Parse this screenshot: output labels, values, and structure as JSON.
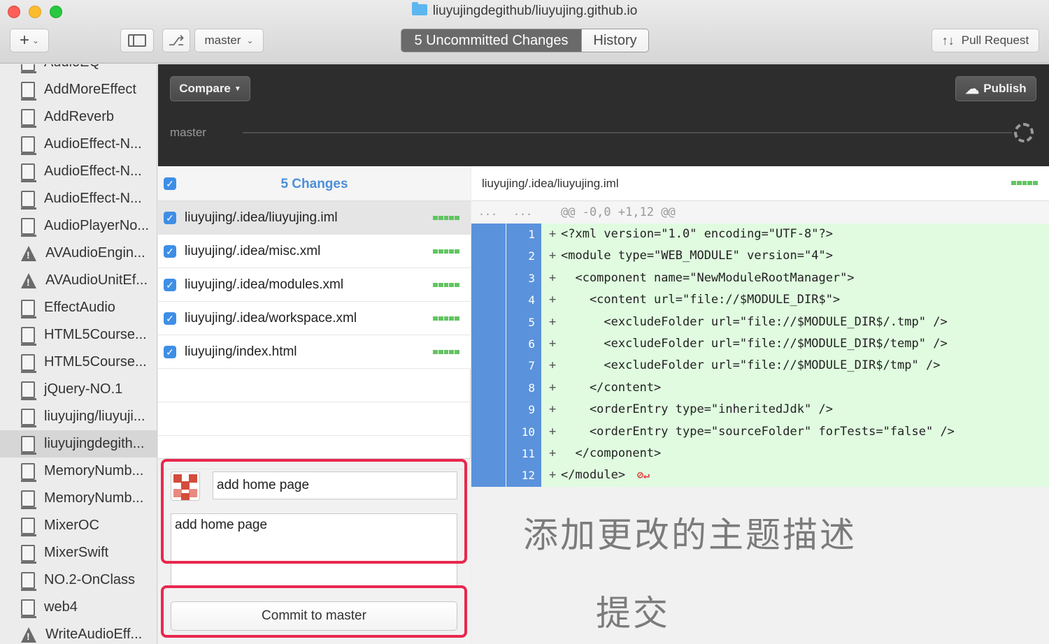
{
  "window": {
    "title": "liuyujingdegithub/liuyujing.github.io"
  },
  "toolbar": {
    "add_label": "+",
    "branch": "master",
    "tabs": [
      {
        "label": "5 Uncommitted Changes",
        "active": true
      },
      {
        "label": "History",
        "active": false
      }
    ],
    "pull_request_label": "Pull Request"
  },
  "sidebar": {
    "items": [
      {
        "label": "AudioEQ",
        "icon": "repo-icon"
      },
      {
        "label": "AddMoreEffect",
        "icon": "repo-icon"
      },
      {
        "label": "AddReverb",
        "icon": "repo-icon"
      },
      {
        "label": "AudioEffect-N...",
        "icon": "repo-icon"
      },
      {
        "label": "AudioEffect-N...",
        "icon": "repo-icon"
      },
      {
        "label": "AudioEffect-N...",
        "icon": "repo-icon"
      },
      {
        "label": "AudioPlayerNo...",
        "icon": "repo-icon"
      },
      {
        "label": "AVAudioEngin...",
        "icon": "warning-icon"
      },
      {
        "label": "AVAudioUnitEf...",
        "icon": "warning-icon"
      },
      {
        "label": "EffectAudio",
        "icon": "repo-icon"
      },
      {
        "label": "HTML5Course...",
        "icon": "repo-icon"
      },
      {
        "label": "HTML5Course...",
        "icon": "repo-icon"
      },
      {
        "label": "jQuery-NO.1",
        "icon": "repo-icon"
      },
      {
        "label": "liuyujing/liuyuji...",
        "icon": "repo-icon"
      },
      {
        "label": "liuyujingdegith...",
        "icon": "repo-icon",
        "selected": true
      },
      {
        "label": "MemoryNumb...",
        "icon": "repo-icon"
      },
      {
        "label": "MemoryNumb...",
        "icon": "repo-icon"
      },
      {
        "label": "MixerOC",
        "icon": "repo-icon"
      },
      {
        "label": "MixerSwift",
        "icon": "repo-icon"
      },
      {
        "label": "NO.2-OnClass",
        "icon": "repo-icon"
      },
      {
        "label": "web4",
        "icon": "repo-icon"
      },
      {
        "label": "WriteAudioEff...",
        "icon": "warning-icon"
      }
    ]
  },
  "compare": {
    "button_label": "Compare",
    "publish_label": "Publish",
    "branch_label": "master"
  },
  "changes": {
    "title": "5 Changes",
    "files": [
      {
        "name": "liuyujing/.idea/liuyujing.iml",
        "checked": true,
        "selected": true
      },
      {
        "name": "liuyujing/.idea/misc.xml",
        "checked": true
      },
      {
        "name": "liuyujing/.idea/modules.xml",
        "checked": true
      },
      {
        "name": "liuyujing/.idea/workspace.xml",
        "checked": true
      },
      {
        "name": "liuyujing/index.html",
        "checked": true
      }
    ]
  },
  "commit": {
    "summary": "add home page",
    "description": "add home page",
    "button_label": "Commit to master"
  },
  "diff": {
    "file": "liuyujing/.idea/liuyujing.iml",
    "hunk_dots": "...",
    "hunk": "@@ -0,0 +1,12 @@",
    "lines": [
      {
        "num": "1",
        "code": "<?xml version=\"1.0\" encoding=\"UTF-8\"?>"
      },
      {
        "num": "2",
        "code": "<module type=\"WEB_MODULE\" version=\"4\">"
      },
      {
        "num": "3",
        "code": "  <component name=\"NewModuleRootManager\">"
      },
      {
        "num": "4",
        "code": "    <content url=\"file://$MODULE_DIR$\">"
      },
      {
        "num": "5",
        "code": "      <excludeFolder url=\"file://$MODULE_DIR$/.tmp\" />"
      },
      {
        "num": "6",
        "code": "      <excludeFolder url=\"file://$MODULE_DIR$/temp\" />"
      },
      {
        "num": "7",
        "code": "      <excludeFolder url=\"file://$MODULE_DIR$/tmp\" />"
      },
      {
        "num": "8",
        "code": "    </content>"
      },
      {
        "num": "9",
        "code": "    <orderEntry type=\"inheritedJdk\" />"
      },
      {
        "num": "10",
        "code": "    <orderEntry type=\"sourceFolder\" forTests=\"false\" />"
      },
      {
        "num": "11",
        "code": "  </component>"
      },
      {
        "num": "12",
        "code": "</module>"
      }
    ]
  },
  "annotations": {
    "subject_note": "添加更改的主题描述",
    "commit_note": "提交"
  },
  "colors": {
    "accent_blue": "#3f8ee6",
    "gutter_blue": "#5b92dc",
    "added_green": "#e0fbe0",
    "diffbar_green": "#62c462",
    "highlight_red": "#e8284e"
  }
}
